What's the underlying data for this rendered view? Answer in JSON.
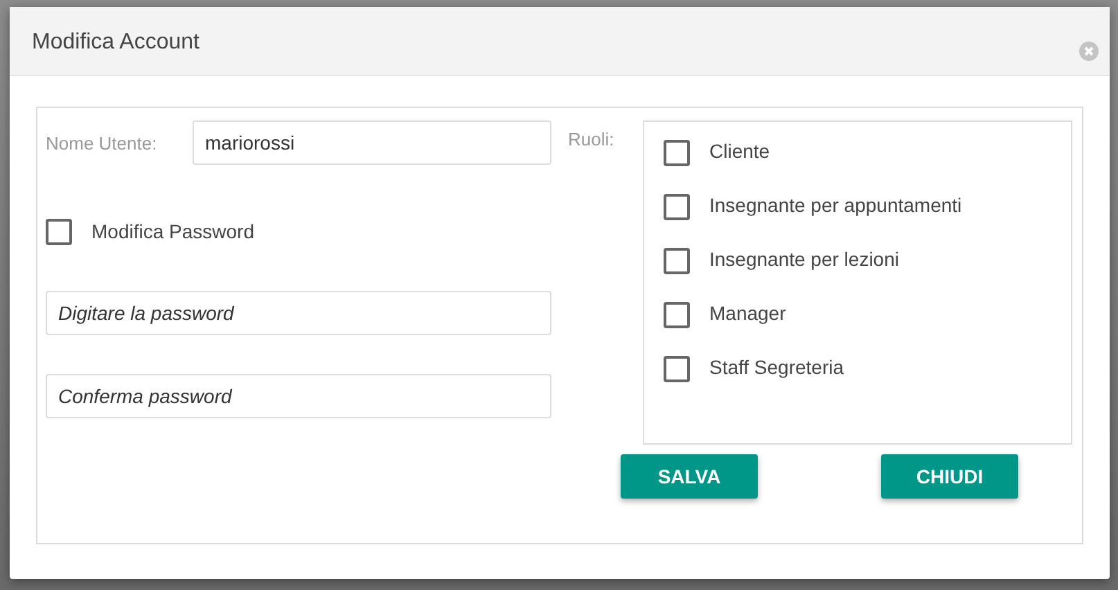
{
  "dialog": {
    "title": "Modifica Account"
  },
  "username": {
    "label": "Nome Utente:",
    "value": "mariorossi"
  },
  "change_password": {
    "label": "Modifica Password",
    "checked": false
  },
  "password_fields": [
    {
      "placeholder": "Digitare la password"
    },
    {
      "placeholder": "Conferma password"
    }
  ],
  "roles": {
    "label": "Ruoli:",
    "items": [
      {
        "label": "Cliente",
        "checked": false
      },
      {
        "label": "Insegnante per appuntamenti",
        "checked": false
      },
      {
        "label": "Insegnante per lezioni",
        "checked": false
      },
      {
        "label": "Manager",
        "checked": false
      },
      {
        "label": "Staff Segreteria",
        "checked": false
      }
    ]
  },
  "buttons": [
    "SALVA",
    "CHIUDI"
  ]
}
